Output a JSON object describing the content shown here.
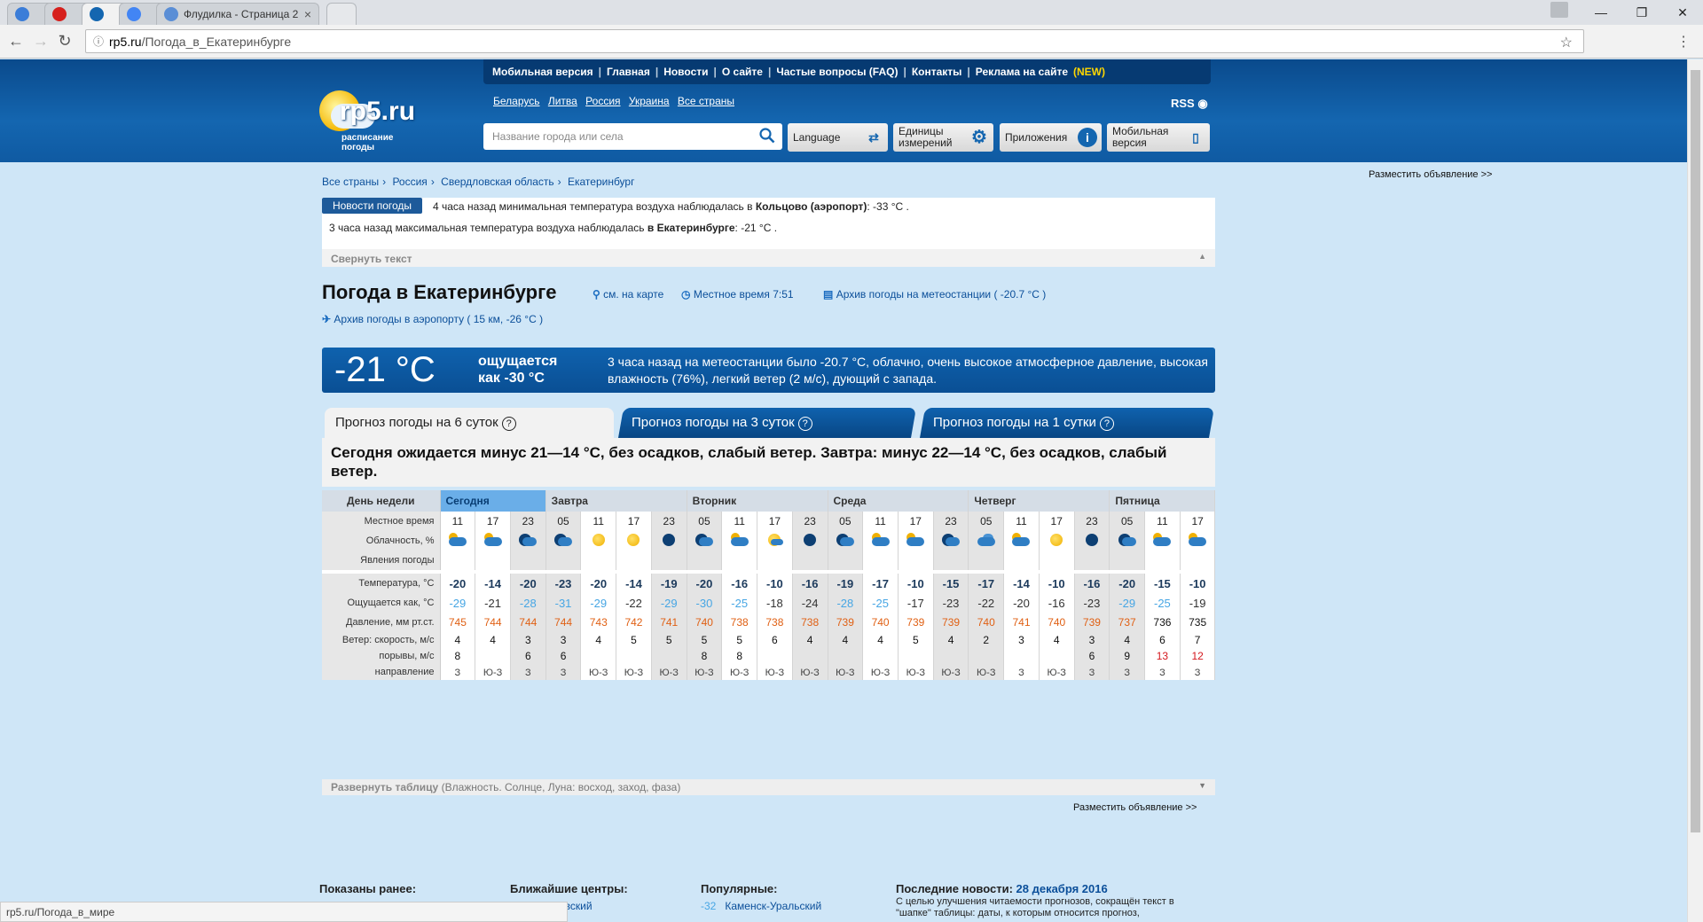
{
  "browser": {
    "tabs": [
      {
        "title": "",
        "color": "#3b7dd8"
      },
      {
        "title": "",
        "color": "#d6201d"
      },
      {
        "title": "",
        "color": "#1466b0"
      },
      {
        "title": "",
        "color": "#4285f4"
      },
      {
        "title": "Флудилка - Страница 2",
        "color": "#5a8ed6"
      },
      {
        "title": "",
        "color": "#ccc"
      }
    ],
    "url_host": "rp5.ru",
    "url_path": "/Погода_в_Екатеринбурге",
    "status_url": "rp5.ru/Погода_в_мире"
  },
  "header": {
    "topmenu": [
      "Мобильная версия",
      "Главная",
      "Новости",
      "О сайте",
      "Частые вопросы (FAQ)",
      "Контакты",
      "Реклама на сайте"
    ],
    "topmenu_new": "(NEW)",
    "logo_text": "rp5.ru",
    "logo_sub1": "расписание",
    "logo_sub2": "погоды",
    "countries": [
      "Беларусь",
      "Литва",
      "Россия",
      "Украина",
      "Все страны"
    ],
    "rss": "RSS",
    "search_placeholder": "Название города или села",
    "btn_language": "Language",
    "btn_units_1": "Единицы",
    "btn_units_2": "измерений",
    "btn_apps": "Приложения",
    "btn_mobile_1": "Мобильная",
    "btn_mobile_2": "версия"
  },
  "ad_top": "Разместить объявление >>",
  "breadcrumbs": [
    "Все страны",
    "Россия",
    "Свердловская область",
    "Екатеринбург"
  ],
  "news": {
    "tag": "Новости погоды",
    "line1_pre": "4 часа назад минимальная температура воздуха наблюдалась в ",
    "line1_bold": "Кольцово (аэропорт)",
    "line1_post": ": -33 °C .",
    "line2_pre": "3 часа назад максимальная температура воздуха наблюдалась ",
    "line2_bold": "в Екатеринбурге",
    "line2_post": ": -21 °C .",
    "collapse": "Свернуть текст"
  },
  "title": "Погода в Екатеринбурге",
  "links": {
    "map": "см. на карте",
    "local_time": "Местное время  7:51",
    "archive": "Архив погоды на метеостанции ( -20.7 °C )",
    "airport": "Архив погоды в аэропорту ( 15 км, -26 °C )"
  },
  "now": {
    "temp": "-21 °C",
    "feels1": "ощущается",
    "feels2": "как -30 °C",
    "desc": "3 часа назад на метеостанции было -20.7 °C, облачно, очень высокое атмосферное давление, высокая влажность (76%), легкий ветер (2 м/с), дующий с запада."
  },
  "tabs": [
    "Прогноз погоды на 6 суток",
    "Прогноз погоды на 3 суток",
    "Прогноз погоды на 1 сутки"
  ],
  "summary": "Сегодня ожидается минус 21—14 °C, без осадков, слабый ветер. Завтра: минус 22—14 °C, без осадков, слабый ветер.",
  "table": {
    "labels": {
      "day": "День недели",
      "time": "Местное время",
      "cloud": "Облачность, %",
      "phen": "Явления погоды",
      "temp": "Температура, °C",
      "feels": "Ощущается как, °C",
      "pressure": "Давление, мм рт.ст.",
      "wind": "Ветер: скорость, м/с",
      "gusts": "порывы, м/с",
      "dir": "направление"
    },
    "days": [
      {
        "name": "Сегодня",
        "span": 3
      },
      {
        "name": "Завтра",
        "span": 4
      },
      {
        "name": "Вторник",
        "span": 4
      },
      {
        "name": "Среда",
        "span": 4
      },
      {
        "name": "Четверг",
        "span": 4
      },
      {
        "name": "Пятница",
        "span": 3
      }
    ],
    "times": [
      "11",
      "17",
      "23",
      "05",
      "11",
      "17",
      "23",
      "05",
      "11",
      "17",
      "23",
      "05",
      "11",
      "17",
      "23",
      "05",
      "11",
      "17",
      "23",
      "05",
      "11",
      "17"
    ],
    "night": [
      false,
      false,
      true,
      true,
      false,
      false,
      true,
      true,
      false,
      false,
      true,
      true,
      false,
      false,
      true,
      true,
      false,
      false,
      true,
      true,
      false,
      false
    ],
    "icons": [
      "sc",
      "sc",
      "mc",
      "mc",
      "s",
      "s",
      "m",
      "mc",
      "sc",
      "ss",
      "m",
      "mc",
      "sc",
      "sc",
      "mc",
      "c",
      "sc",
      "s",
      "m",
      "mc",
      "sc",
      "sc"
    ],
    "temps": [
      "-20",
      "-14",
      "-20",
      "-23",
      "-20",
      "-14",
      "-19",
      "-20",
      "-16",
      "-10",
      "-16",
      "-19",
      "-17",
      "-10",
      "-15",
      "-17",
      "-14",
      "-10",
      "-16",
      "-20",
      "-15",
      "-10"
    ],
    "feels": [
      {
        "v": "-29",
        "c": true
      },
      {
        "v": "-21",
        "c": false
      },
      {
        "v": "-28",
        "c": true
      },
      {
        "v": "-31",
        "c": true
      },
      {
        "v": "-29",
        "c": true
      },
      {
        "v": "-22",
        "c": false
      },
      {
        "v": "-29",
        "c": true
      },
      {
        "v": "-30",
        "c": true
      },
      {
        "v": "-25",
        "c": true
      },
      {
        "v": "-18",
        "c": false
      },
      {
        "v": "-24",
        "c": false
      },
      {
        "v": "-28",
        "c": true
      },
      {
        "v": "-25",
        "c": true
      },
      {
        "v": "-17",
        "c": false
      },
      {
        "v": "-23",
        "c": false
      },
      {
        "v": "-22",
        "c": false
      },
      {
        "v": "-20",
        "c": false
      },
      {
        "v": "-16",
        "c": false
      },
      {
        "v": "-23",
        "c": false
      },
      {
        "v": "-29",
        "c": true
      },
      {
        "v": "-25",
        "c": true
      },
      {
        "v": "-19",
        "c": false
      }
    ],
    "pressure": [
      {
        "v": "745",
        "o": true
      },
      {
        "v": "744",
        "o": true
      },
      {
        "v": "744",
        "o": true
      },
      {
        "v": "744",
        "o": true
      },
      {
        "v": "743",
        "o": true
      },
      {
        "v": "742",
        "o": true
      },
      {
        "v": "741",
        "o": true
      },
      {
        "v": "740",
        "o": true
      },
      {
        "v": "738",
        "o": true
      },
      {
        "v": "738",
        "o": true
      },
      {
        "v": "738",
        "o": true
      },
      {
        "v": "739",
        "o": true
      },
      {
        "v": "740",
        "o": true
      },
      {
        "v": "739",
        "o": true
      },
      {
        "v": "739",
        "o": true
      },
      {
        "v": "740",
        "o": true
      },
      {
        "v": "741",
        "o": true
      },
      {
        "v": "740",
        "o": true
      },
      {
        "v": "739",
        "o": true
      },
      {
        "v": "737",
        "o": true
      },
      {
        "v": "736",
        "o": false
      },
      {
        "v": "735",
        "o": false
      }
    ],
    "wind": [
      "4",
      "4",
      "3",
      "3",
      "4",
      "5",
      "5",
      "5",
      "5",
      "6",
      "4",
      "4",
      "4",
      "5",
      "4",
      "2",
      "3",
      "4",
      "3",
      "4",
      "6",
      "7"
    ],
    "gusts": [
      {
        "v": "8",
        "r": false
      },
      {
        "v": "",
        "r": false
      },
      {
        "v": "6",
        "r": false
      },
      {
        "v": "6",
        "r": false
      },
      {
        "v": "",
        "r": false
      },
      {
        "v": "",
        "r": false
      },
      {
        "v": "",
        "r": false
      },
      {
        "v": "8",
        "r": false
      },
      {
        "v": "8",
        "r": false
      },
      {
        "v": "",
        "r": false
      },
      {
        "v": "",
        "r": false
      },
      {
        "v": "",
        "r": false
      },
      {
        "v": "",
        "r": false
      },
      {
        "v": "",
        "r": false
      },
      {
        "v": "",
        "r": false
      },
      {
        "v": "",
        "r": false
      },
      {
        "v": "",
        "r": false
      },
      {
        "v": "",
        "r": false
      },
      {
        "v": "6",
        "r": false
      },
      {
        "v": "9",
        "r": false
      },
      {
        "v": "13",
        "r": true
      },
      {
        "v": "12",
        "r": true
      }
    ],
    "dirs": [
      "З",
      "Ю-З",
      "З",
      "З",
      "Ю-З",
      "Ю-З",
      "Ю-З",
      "Ю-З",
      "Ю-З",
      "Ю-З",
      "Ю-З",
      "Ю-З",
      "Ю-З",
      "Ю-З",
      "Ю-З",
      "Ю-З",
      "З",
      "Ю-З",
      "З",
      "З",
      "З",
      "З"
    ],
    "expand_bold": "Развернуть таблицу",
    "expand_rest": " (Влажность. Солнце, Луна: восход, заход, фаза)"
  },
  "ad_mid": "Разместить объявление >>",
  "footer": {
    "shown": "Показаны ранее:",
    "centers": "Ближайшие центры:",
    "centers_item": "овский",
    "popular": "Популярные:",
    "popular_temp": "-32",
    "popular_item": "Каменск-Уральский",
    "latest": "Последние новости: ",
    "latest_date": "28 декабря 2016",
    "latest_text1": "С целью улучшения читаемости прогнозов, сокращён текст в",
    "latest_text2": "\"шапке\" таблицы: даты, к которым относится прогноз,"
  }
}
